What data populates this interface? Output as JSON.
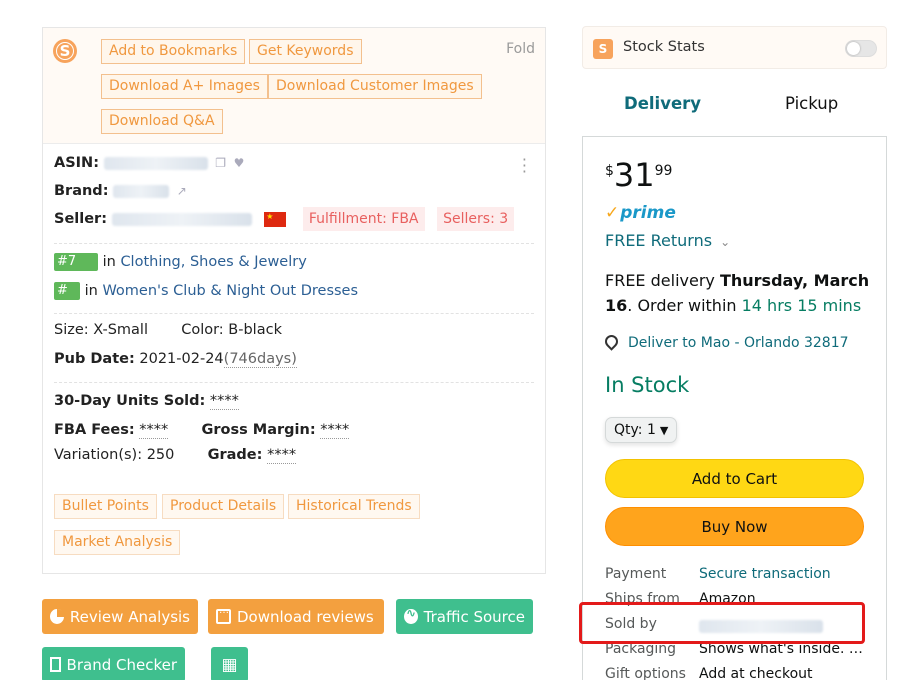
{
  "extension": {
    "fold_label": "Fold",
    "toolbar": {
      "bookmarks": "Add to Bookmarks",
      "keywords": "Get Keywords",
      "aplus": "Download A+ Images",
      "customer_images": "Download Customer Images",
      "qa": "Download Q&A"
    },
    "info": {
      "asin_label": "ASIN:",
      "brand_label": "Brand:",
      "seller_label": "Seller:",
      "fulfillment": "Fulfillment: FBA",
      "sellers_count": "Sellers: 3",
      "rank1_prefix": "#7",
      "rank1_in": "in",
      "rank1_category": "Clothing, Shoes & Jewelry",
      "rank2_prefix": "#",
      "rank2_in": "in",
      "rank2_category": "Women's Club & Night Out Dresses",
      "size": "Size: X-Small",
      "color": "Color: B-black",
      "pub_date_label": "Pub Date:",
      "pub_date": "2021-02-24",
      "pub_days": "(746days)",
      "units_label": "30-Day Units Sold:",
      "units_value": "****",
      "fba_label": "FBA Fees:",
      "fba_value": "****",
      "margin_label": "Gross Margin:",
      "margin_value": "****",
      "variation": "Variation(s): 250",
      "grade_label": "Grade:",
      "grade_value": "****"
    },
    "tabs": {
      "bullets": "Bullet Points",
      "details": "Product Details",
      "trends": "Historical Trends",
      "market": "Market Analysis"
    }
  },
  "actions": {
    "review_analysis": "Review Analysis",
    "download_reviews": "Download reviews",
    "traffic_source": "Traffic Source",
    "brand_checker": "Brand Checker"
  },
  "stock_stats": {
    "title": "Stock Stats"
  },
  "delivery_tabs": {
    "delivery": "Delivery",
    "pickup": "Pickup"
  },
  "buybox": {
    "price_symbol": "$",
    "price_whole": "31",
    "price_fraction": "99",
    "prime": "prime",
    "free_returns": "FREE Returns",
    "delivery_1": "FREE delivery ",
    "delivery_date": "Thursday, March 16",
    "delivery_2": ". Order within ",
    "delivery_window": "14 hrs 15 mins",
    "deliver_to": "Deliver to Mao - Orlando 32817",
    "in_stock": "In Stock",
    "qty_label": "Qty: 1",
    "add_to_cart": "Add to Cart",
    "buy_now": "Buy Now",
    "details": [
      {
        "label": "Payment",
        "value": "Secure transaction"
      },
      {
        "label": "Ships from",
        "value": "Amazon"
      },
      {
        "label": "Sold by",
        "value": ""
      },
      {
        "label": "Packaging",
        "value": "Shows what's inside. …"
      },
      {
        "label": "Gift options",
        "value": "Add at checkout"
      }
    ]
  }
}
